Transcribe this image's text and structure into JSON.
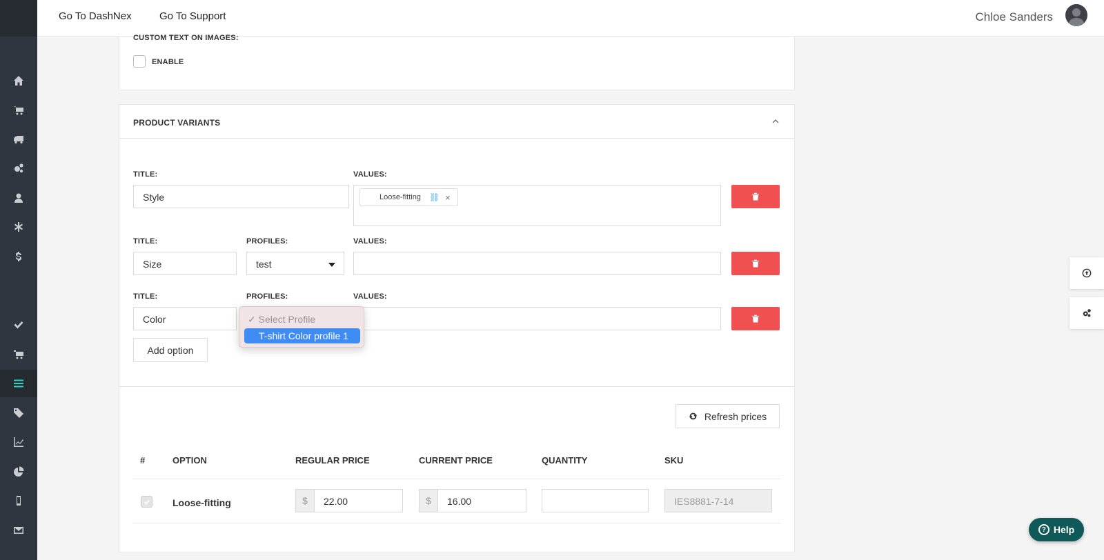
{
  "topbar": {
    "links": [
      "Go To DashNex",
      "Go To Support"
    ],
    "user_name": "Chloe Sanders"
  },
  "sidebar": {
    "icons": [
      "home-icon",
      "cart-icon",
      "truck-icon",
      "gears-icon",
      "user-icon",
      "asterisk-icon",
      "dollar-icon",
      "check-icon",
      "cart-icon-2",
      "list-icon",
      "tags-icon",
      "line-chart-icon",
      "pie-chart-icon",
      "mobile-icon",
      "envelope-icon"
    ],
    "active": "list-icon"
  },
  "custom_text": {
    "heading": "CUSTOM TEXT ON IMAGES:",
    "enable_label": "ENABLE"
  },
  "variants": {
    "heading": "PRODUCT VARIANTS",
    "labels": {
      "title": "TITLE:",
      "profiles": "PROFILES:",
      "values": "VALUES:"
    },
    "rows": [
      {
        "title": "Style",
        "value_tag": "Loose-fitting"
      },
      {
        "title": "Size",
        "profile": "test"
      },
      {
        "title": "Color"
      }
    ],
    "dropdown": {
      "options": [
        "✓ Select Profile",
        "T-shirt Color profile 1"
      ],
      "highlighted": "T-shirt Color profile 1"
    },
    "add_option": "Add option"
  },
  "pricing": {
    "refresh_label": "Refresh prices",
    "columns": [
      "#",
      "OPTION",
      "REGULAR PRICE",
      "CURRENT PRICE",
      "QUANTITY",
      "SKU"
    ],
    "rows": [
      {
        "checked": true,
        "option": "Loose-fitting",
        "currency": "$",
        "regular_price": "22.00",
        "current_price": "16.00",
        "quantity": "",
        "sku": "IES8881-7-14"
      }
    ]
  },
  "help_label": "Help",
  "colors": {
    "sidebar": "#2f3640",
    "accent": "#2bd3c4",
    "delete": "#f0504f",
    "dropdown_highlight": "#3f8cf4",
    "help": "#0f5959"
  }
}
